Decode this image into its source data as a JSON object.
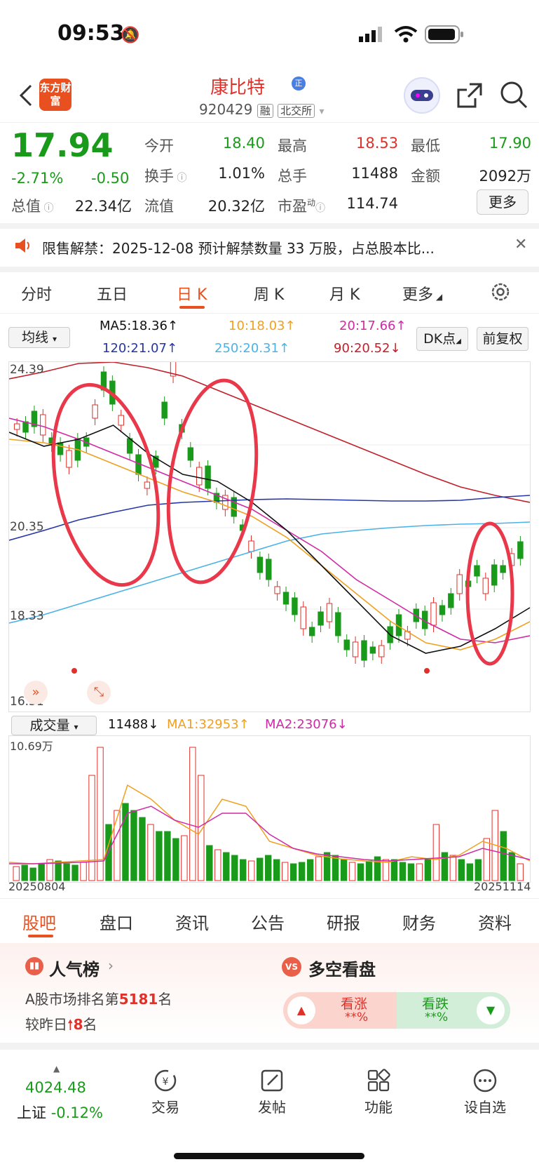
{
  "status_bar": {
    "time": "09:53"
  },
  "header": {
    "logo_text": "东方财富",
    "name": "康比特",
    "code": "920429",
    "tags": [
      "融",
      "北交所"
    ]
  },
  "quote": {
    "price": "17.94",
    "change_pct": "-2.71%",
    "change": "-0.50",
    "fields": [
      {
        "label": "今开",
        "value": "18.40"
      },
      {
        "label": "最高",
        "value": "18.53"
      },
      {
        "label": "最低",
        "value": "17.90"
      },
      {
        "label": "换手",
        "value": "1.01%"
      },
      {
        "label": "总手",
        "value": "11488"
      },
      {
        "label": "金额",
        "value": "2092万"
      },
      {
        "label": "总值",
        "value": "22.34亿"
      },
      {
        "label": "流值",
        "value": "20.32亿"
      },
      {
        "label": "市盈",
        "sup": "动",
        "value": "114.74"
      }
    ],
    "more_label": "更多"
  },
  "notice": {
    "text": "限售解禁：2025-12-08 预计解禁数量 33 万股，占总股本比..."
  },
  "chart_tabs": [
    "分时",
    "五日",
    "日 K",
    "周 K",
    "月 K",
    "更多"
  ],
  "active_tab": "日 K",
  "ma_bar": {
    "selector": "均线",
    "items": [
      "MA5:18.36↑",
      "10:18.03↑",
      "20:17.66↑",
      "120:21.07↑",
      "250:20.31↑",
      "90:20.52↓"
    ],
    "dk_label": "DK点",
    "adj_label": "前复权"
  },
  "price_axis": [
    "24.39",
    "20.35",
    "18.33",
    "16.31"
  ],
  "volume_bar": {
    "selector": "成交量",
    "value": "11488↓",
    "ma1": "MA1:32953↑",
    "ma2": "MA2:23076↓",
    "axis_top": "10.69万",
    "date_start": "20250804",
    "date_end": "20251114"
  },
  "chart_data": {
    "type": "candlestick",
    "y_range": [
      16.31,
      24.39
    ],
    "volume_max_wan": 10.69,
    "x_range": [
      "20250804",
      "20251114"
    ]
  },
  "bottom_tabs": [
    "股吧",
    "盘口",
    "资讯",
    "公告",
    "研报",
    "财务",
    "资料"
  ],
  "cards": {
    "popularity": {
      "title": "人气榜",
      "line1_pre": "A股市场排名第",
      "rank": "5181",
      "line1_post": "名",
      "line2_pre": "较昨日",
      "delta": "8",
      "line2_post": "名"
    },
    "sentiment": {
      "title": "多空看盘",
      "up_label": "看涨",
      "up_value": "**%",
      "down_label": "看跌",
      "down_value": "**%"
    }
  },
  "bottom_nav": {
    "index_value": "4024.48",
    "index_name": "上证",
    "index_change": "-0.12%",
    "items": [
      "交易",
      "发帖",
      "功能",
      "设自选"
    ]
  },
  "colors": {
    "up": "#e0302a",
    "down": "#1a9a1a",
    "accent": "#e8501f"
  }
}
